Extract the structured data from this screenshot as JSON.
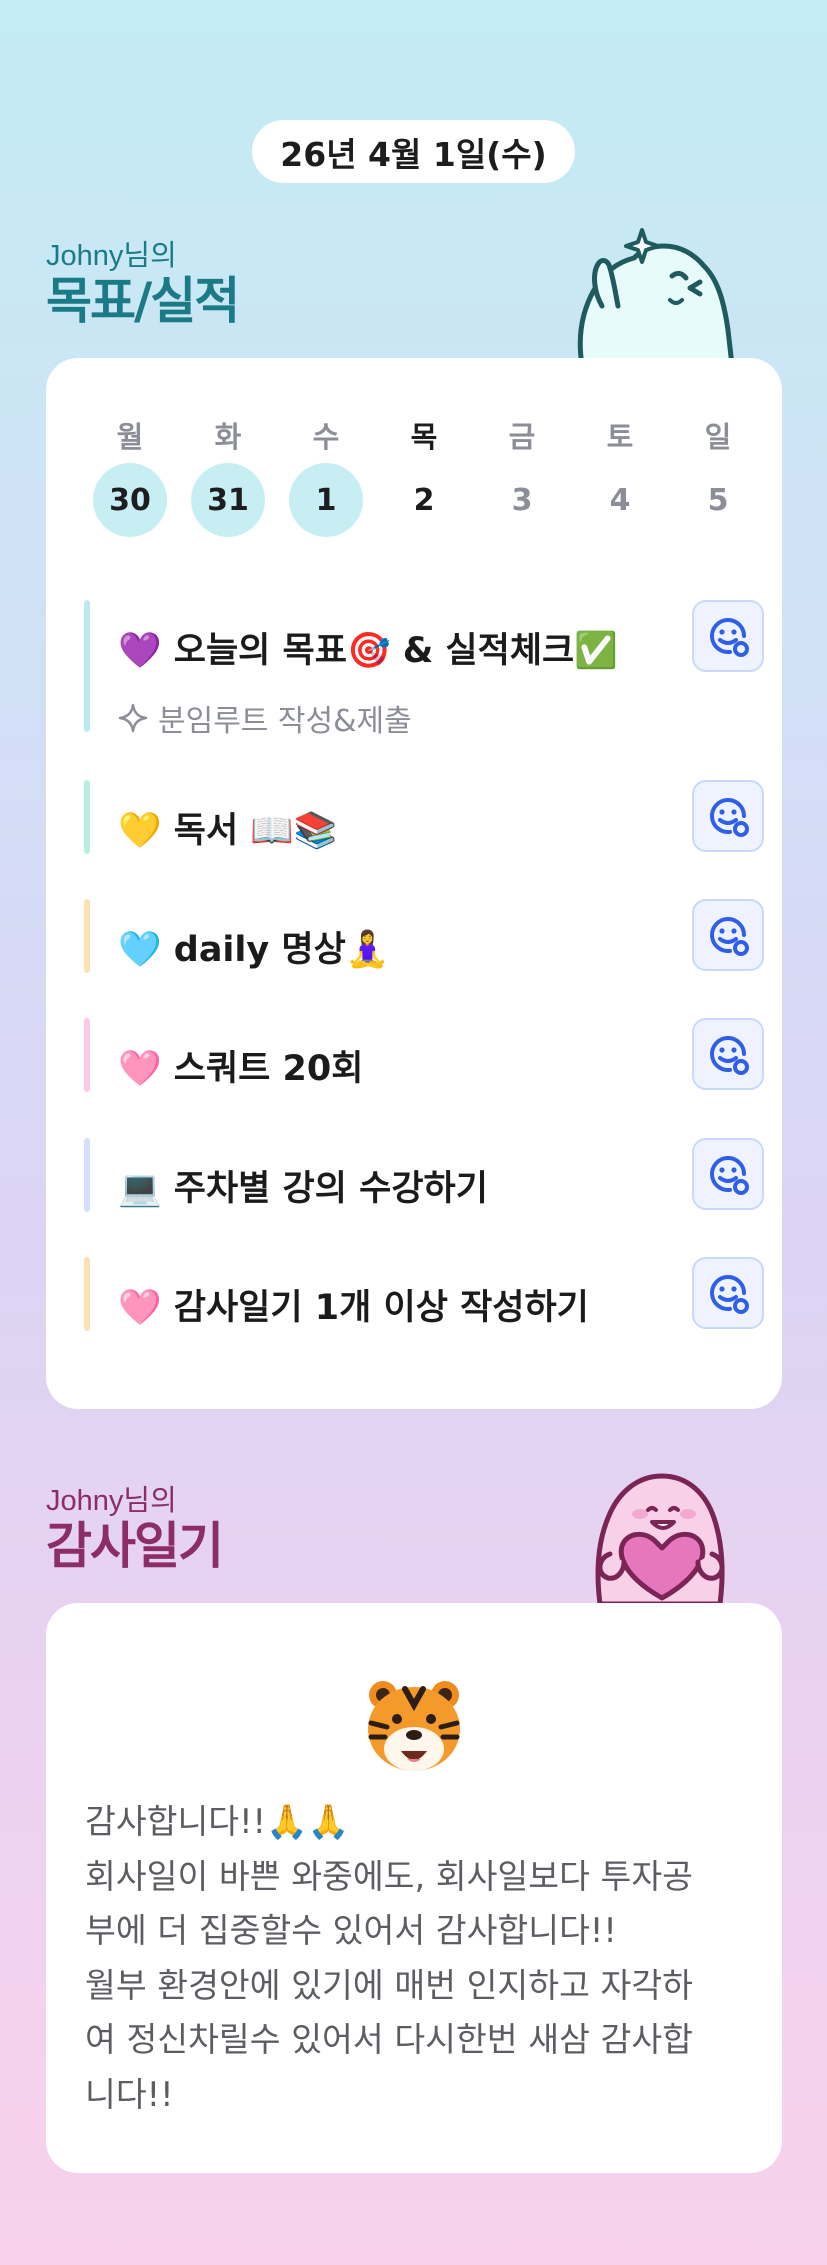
{
  "date_label": "26년 4월 1일(수)",
  "goals_section": {
    "user_label": "Johny님의",
    "title": "목표/실적"
  },
  "week": [
    {
      "day": "월",
      "date": "30",
      "state": "done"
    },
    {
      "day": "화",
      "date": "31",
      "state": "done"
    },
    {
      "day": "수",
      "date": "1",
      "state": "done"
    },
    {
      "day": "목",
      "date": "2",
      "state": "today"
    },
    {
      "day": "금",
      "date": "3",
      "state": "future"
    },
    {
      "day": "토",
      "date": "4",
      "state": "future"
    },
    {
      "day": "일",
      "date": "5",
      "state": "future"
    }
  ],
  "tasks": [
    {
      "title": "💜 오늘의 목표🎯 & 실적체크✅",
      "subtitle": "분임루트 작성&제출",
      "bar_color": "#b9eaf0",
      "reaction_icon": "smiley-add-icon"
    },
    {
      "title": "💛 독서 📖📚",
      "bar_color": "#b9eedc",
      "reaction_icon": "smiley-add-icon"
    },
    {
      "title": "🩵 daily 명상🧘‍♀️",
      "bar_color": "#fde0b4",
      "reaction_icon": "smiley-add-icon"
    },
    {
      "title": "🩷 스쿼트 20회",
      "bar_color": "#fbc9e6",
      "reaction_icon": "smiley-add-icon"
    },
    {
      "title": "💻 주차별 강의 수강하기",
      "bar_color": "#d4e0fb",
      "reaction_icon": "smiley-add-icon"
    },
    {
      "title": "🩷 감사일기 1개 이상 작성하기",
      "bar_color": "#fde0b4",
      "reaction_icon": "smiley-add-icon"
    }
  ],
  "thanks_section": {
    "user_label": "Johny님의",
    "title": "감사일기",
    "entry_emoji": "🐯",
    "entry_text": "감사합니다!!🙏🙏\n회사일이 바쁜 와중에도, 회사일보다 투자공\n부에 더 집중할수 있어서 감사합니다!!\n월부 환경안에 있기에 매번 인지하고 자각하\n여 정신차릴수 있어서 다시한번 새삼 감사합\n니다!!"
  },
  "colors": {
    "accent_teal": "#1a7a86",
    "accent_plum": "#8c2d6a",
    "reaction_blue": "#2f5fe8"
  }
}
